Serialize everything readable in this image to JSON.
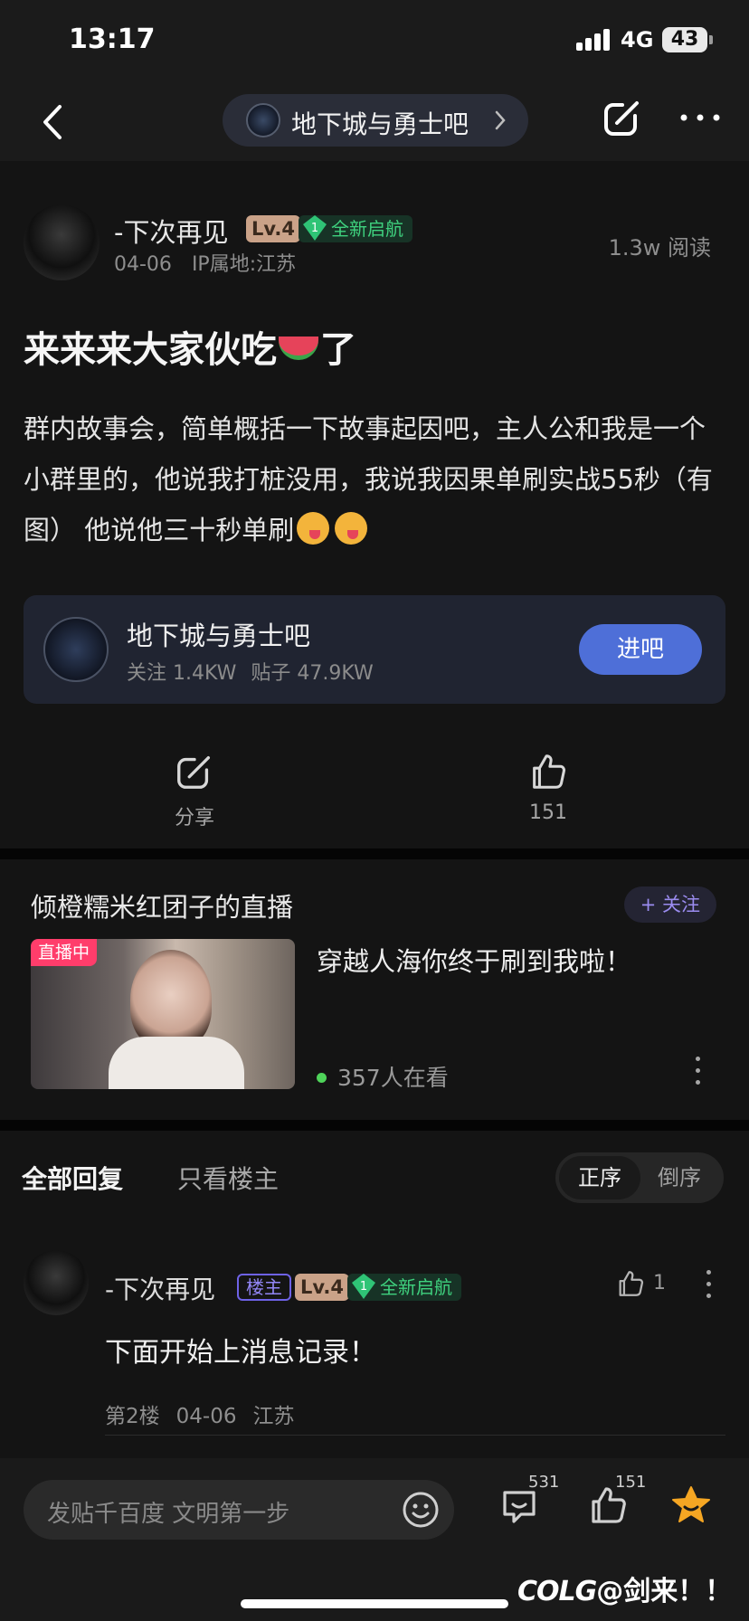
{
  "status_bar": {
    "time": "13:17",
    "network": "4G",
    "battery": "43"
  },
  "nav": {
    "forum_name": "地下城与勇士吧"
  },
  "post": {
    "author": "-下次再见",
    "level": "Lv.4",
    "tag": "全新启航",
    "tag_num": "1",
    "date": "04-06",
    "ip": "IP属地:江苏",
    "views": "1.3w 阅读",
    "title_a": "来来来大家伙吃",
    "title_b": "了",
    "body_a": "群内故事会，简单概括一下故事起因吧，主人公和我是一个小群里的，他说我打桩没用，我说我因果单刷实战55秒（有图） 他说他三十秒单刷"
  },
  "forum_card": {
    "name": "地下城与勇士吧",
    "follow": "关注 1.4KW",
    "posts": "贴子 47.9KW",
    "enter": "进吧"
  },
  "actions": {
    "share": "分享",
    "likes": "151"
  },
  "live": {
    "title": "倾橙糯米红团子的直播",
    "follow": "+ 关注",
    "badge": "直播中",
    "desc": "穿越人海你终于刷到我啦！",
    "watching": "357人在看"
  },
  "replies_header": {
    "tab_all": "全部回复",
    "tab_op": "只看楼主",
    "sort_asc": "正序",
    "sort_desc": "倒序"
  },
  "reply": {
    "author": "-下次再见",
    "op_badge": "楼主",
    "level": "Lv.4",
    "tag": "全新启航",
    "tag_num": "1",
    "likes": "1",
    "text": "下面开始上消息记录！",
    "floor": "第2楼",
    "date": "04-06",
    "location": "江苏"
  },
  "bottom_bar": {
    "placeholder": "发贴千百度 文明第一步",
    "comments": "531",
    "likes": "151"
  },
  "watermark": {
    "brand": "COLG",
    "text": "@剑来！！"
  },
  "colors": {
    "accent_blue": "#4e6fd8",
    "live_red": "#ff3d6b",
    "level_bg": "#caa288",
    "tag_green": "#3fd17e",
    "op_purple": "#9286f5",
    "star": "#f5a623"
  },
  "icons": [
    "back-icon",
    "chevron-right-icon",
    "share-icon",
    "more-icon",
    "thumb-up-icon",
    "kebab-icon",
    "smile-icon",
    "comment-icon",
    "star-icon",
    "gem-icon"
  ]
}
